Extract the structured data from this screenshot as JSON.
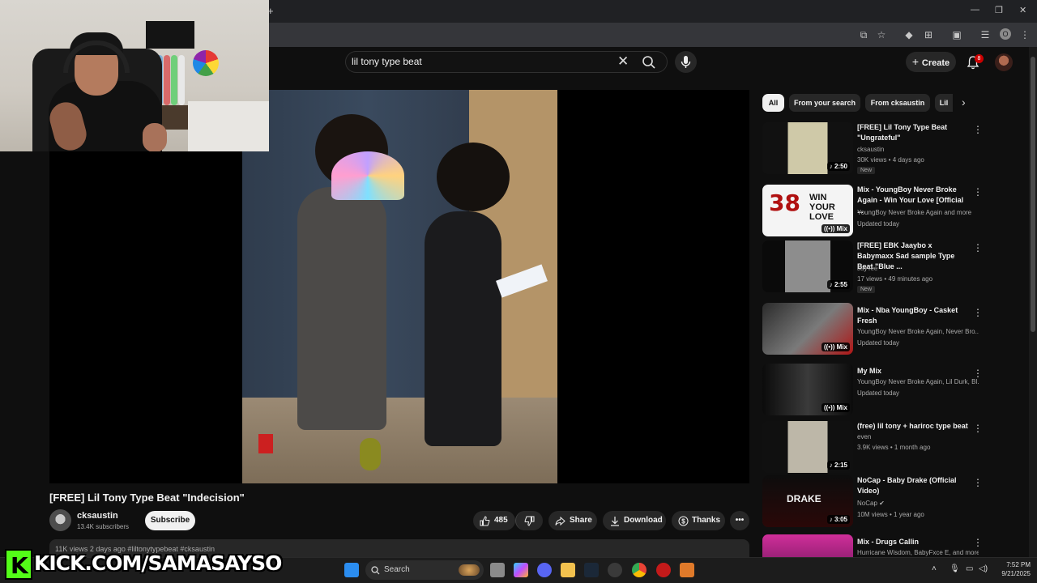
{
  "browser": {
    "new_tab": "+",
    "window_controls": [
      "—",
      "❐",
      "✕"
    ],
    "profile_initial": "O"
  },
  "header": {
    "search_value": "lil tony type beat",
    "create_label": "Create",
    "notification_count": "8"
  },
  "video": {
    "title": "[FREE] Lil Tony Type Beat \"Indecision\"",
    "channel": "cksaustin",
    "subscribers": "13.4K subscribers",
    "subscribe_label": "Subscribe",
    "likes": "485",
    "share_label": "Share",
    "download_label": "Download",
    "thanks_label": "Thanks",
    "description_preview": "11K views  2 days ago  #liltonytypebeat #cksaustin"
  },
  "chips": [
    "All",
    "From your search",
    "From cksaustin",
    "Lil"
  ],
  "related": [
    {
      "title": "[FREE] Lil Tony Type Beat \"Ungrateful\"",
      "channel": "cksaustin",
      "meta": "30K views • 4 days ago",
      "badge": "New",
      "duration": "2:50"
    },
    {
      "title": "Mix - YoungBoy Never Broke Again - Win Your Love [Official ...",
      "channel": "YoungBoy Never Broke Again and more",
      "meta": "Updated today",
      "badge": "",
      "duration": "Mix"
    },
    {
      "title": "[FREE] EBK Jaaybo x Babymaxx Sad sample Type Beat \"Blue ...",
      "channel": "JayTee",
      "meta": "17 views • 49 minutes ago",
      "badge": "New",
      "duration": "2:55"
    },
    {
      "title": "Mix - Nba YoungBoy - Casket Fresh",
      "channel": "YoungBoy Never Broke Again, Never Bro...",
      "meta": "Updated today",
      "badge": "",
      "duration": "Mix"
    },
    {
      "title": "My Mix",
      "channel": "YoungBoy Never Broke Again, Lil Durk, Bl...",
      "meta": "Updated today",
      "badge": "",
      "duration": "Mix"
    },
    {
      "title": "(free) lil tony + hariroc type beat",
      "channel": "even",
      "meta": "3.9K views • 1 month ago",
      "badge": "",
      "duration": "2:15"
    },
    {
      "title": "NoCap - Baby Drake (Official Video)",
      "channel": "NoCap ✔",
      "meta": "10M views • 1 year ago",
      "badge": "",
      "duration": "3:05"
    },
    {
      "title": "Mix - Drugs Callin",
      "channel": "Hurricane Wisdom, BabyFxce E, and more",
      "meta": "",
      "badge": "",
      "duration": ""
    }
  ],
  "thumb_texts": {
    "win_your_love": "WIN YOUR LOVE",
    "thirty_eight": "38",
    "baby_drake": "DRAKE"
  },
  "overlay": {
    "kick_letter": "K",
    "kick_url": "KICK.COM/SAMASAYSO"
  },
  "taskbar": {
    "search_label": "Search",
    "time": "7:52 PM",
    "date": "9/21/2025"
  }
}
